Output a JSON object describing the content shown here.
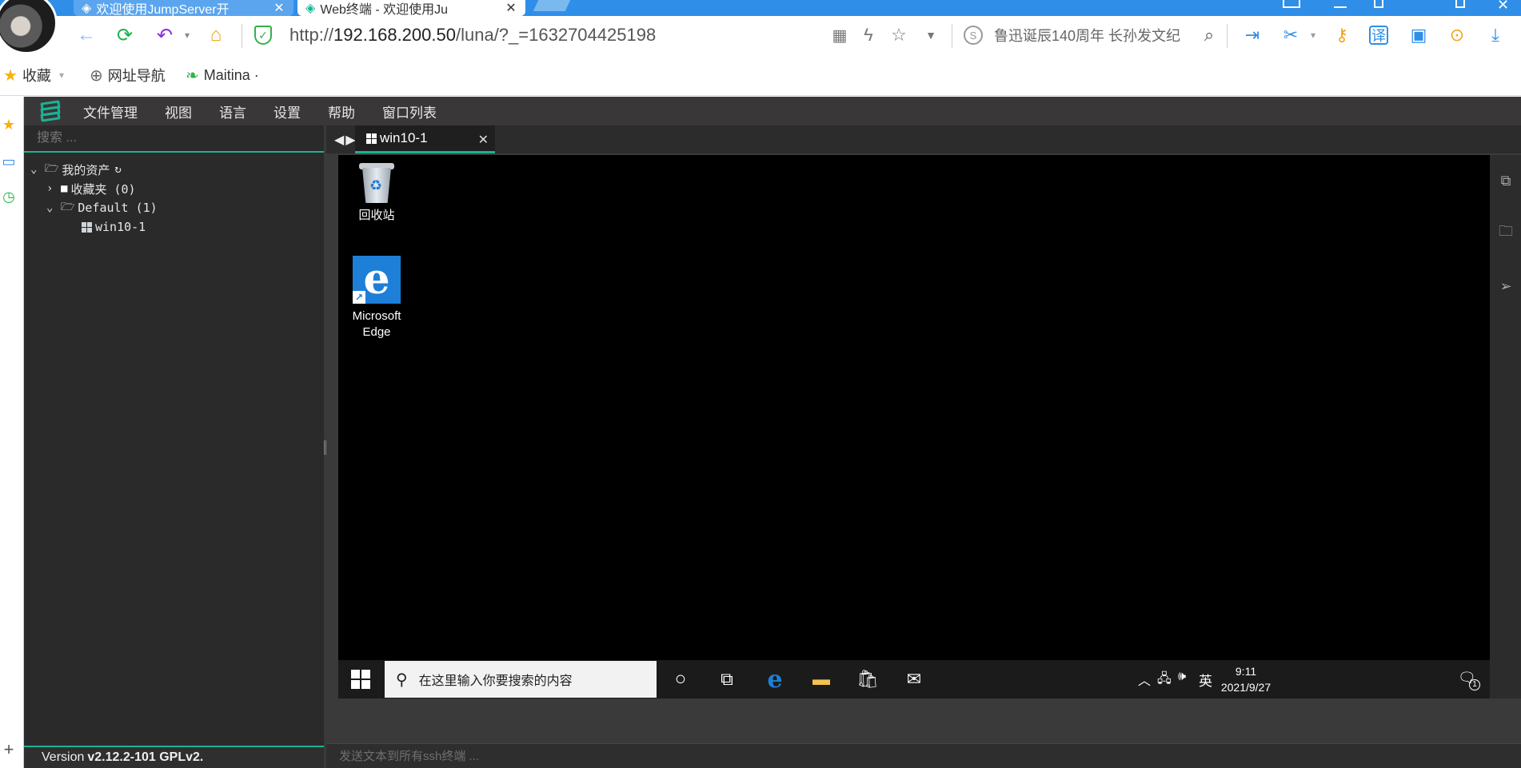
{
  "browser": {
    "tabs": [
      {
        "title": "欢迎使用JumpServer开",
        "state": "inactive"
      },
      {
        "title": "Web终端 - 欢迎使用Ju",
        "state": "active"
      }
    ],
    "url_prefix": "http://",
    "url_host": "192.168.200.50",
    "url_path": "/luna/?_=1632704425198",
    "search_text": "鲁迅诞辰140周年 长孙发文纪",
    "bookmarks": [
      {
        "label": "收藏",
        "icon": "star-icon"
      },
      {
        "label": "网址导航",
        "icon": "globe-icon"
      },
      {
        "label": "Maitina ·",
        "icon": "leaf-icon"
      }
    ],
    "colors": {
      "tabbar": "#2f8ee8",
      "accent": "#1ab394"
    }
  },
  "luna": {
    "menu": [
      "文件管理",
      "视图",
      "语言",
      "设置",
      "帮助",
      "窗口列表"
    ],
    "search_placeholder": "搜索 ...",
    "tree": {
      "root": "我的资产",
      "favorites": "收藏夹 (0)",
      "default_group": "Default (1)",
      "asset": "win10-1"
    },
    "version_prefix": "Version",
    "version": "v2.12.2-101 GPLv2.",
    "session_tab": "win10-1",
    "send_placeholder": "发送文本到所有ssh终端 ..."
  },
  "desktop": {
    "icons": [
      {
        "label": "回收站"
      },
      {
        "label": "Microsoft Edge"
      }
    ],
    "taskbar": {
      "search_placeholder": "在这里输入你要搜索的内容",
      "ime": "英",
      "time": "9:11",
      "date": "2021/9/27",
      "notification_count": "1"
    }
  }
}
